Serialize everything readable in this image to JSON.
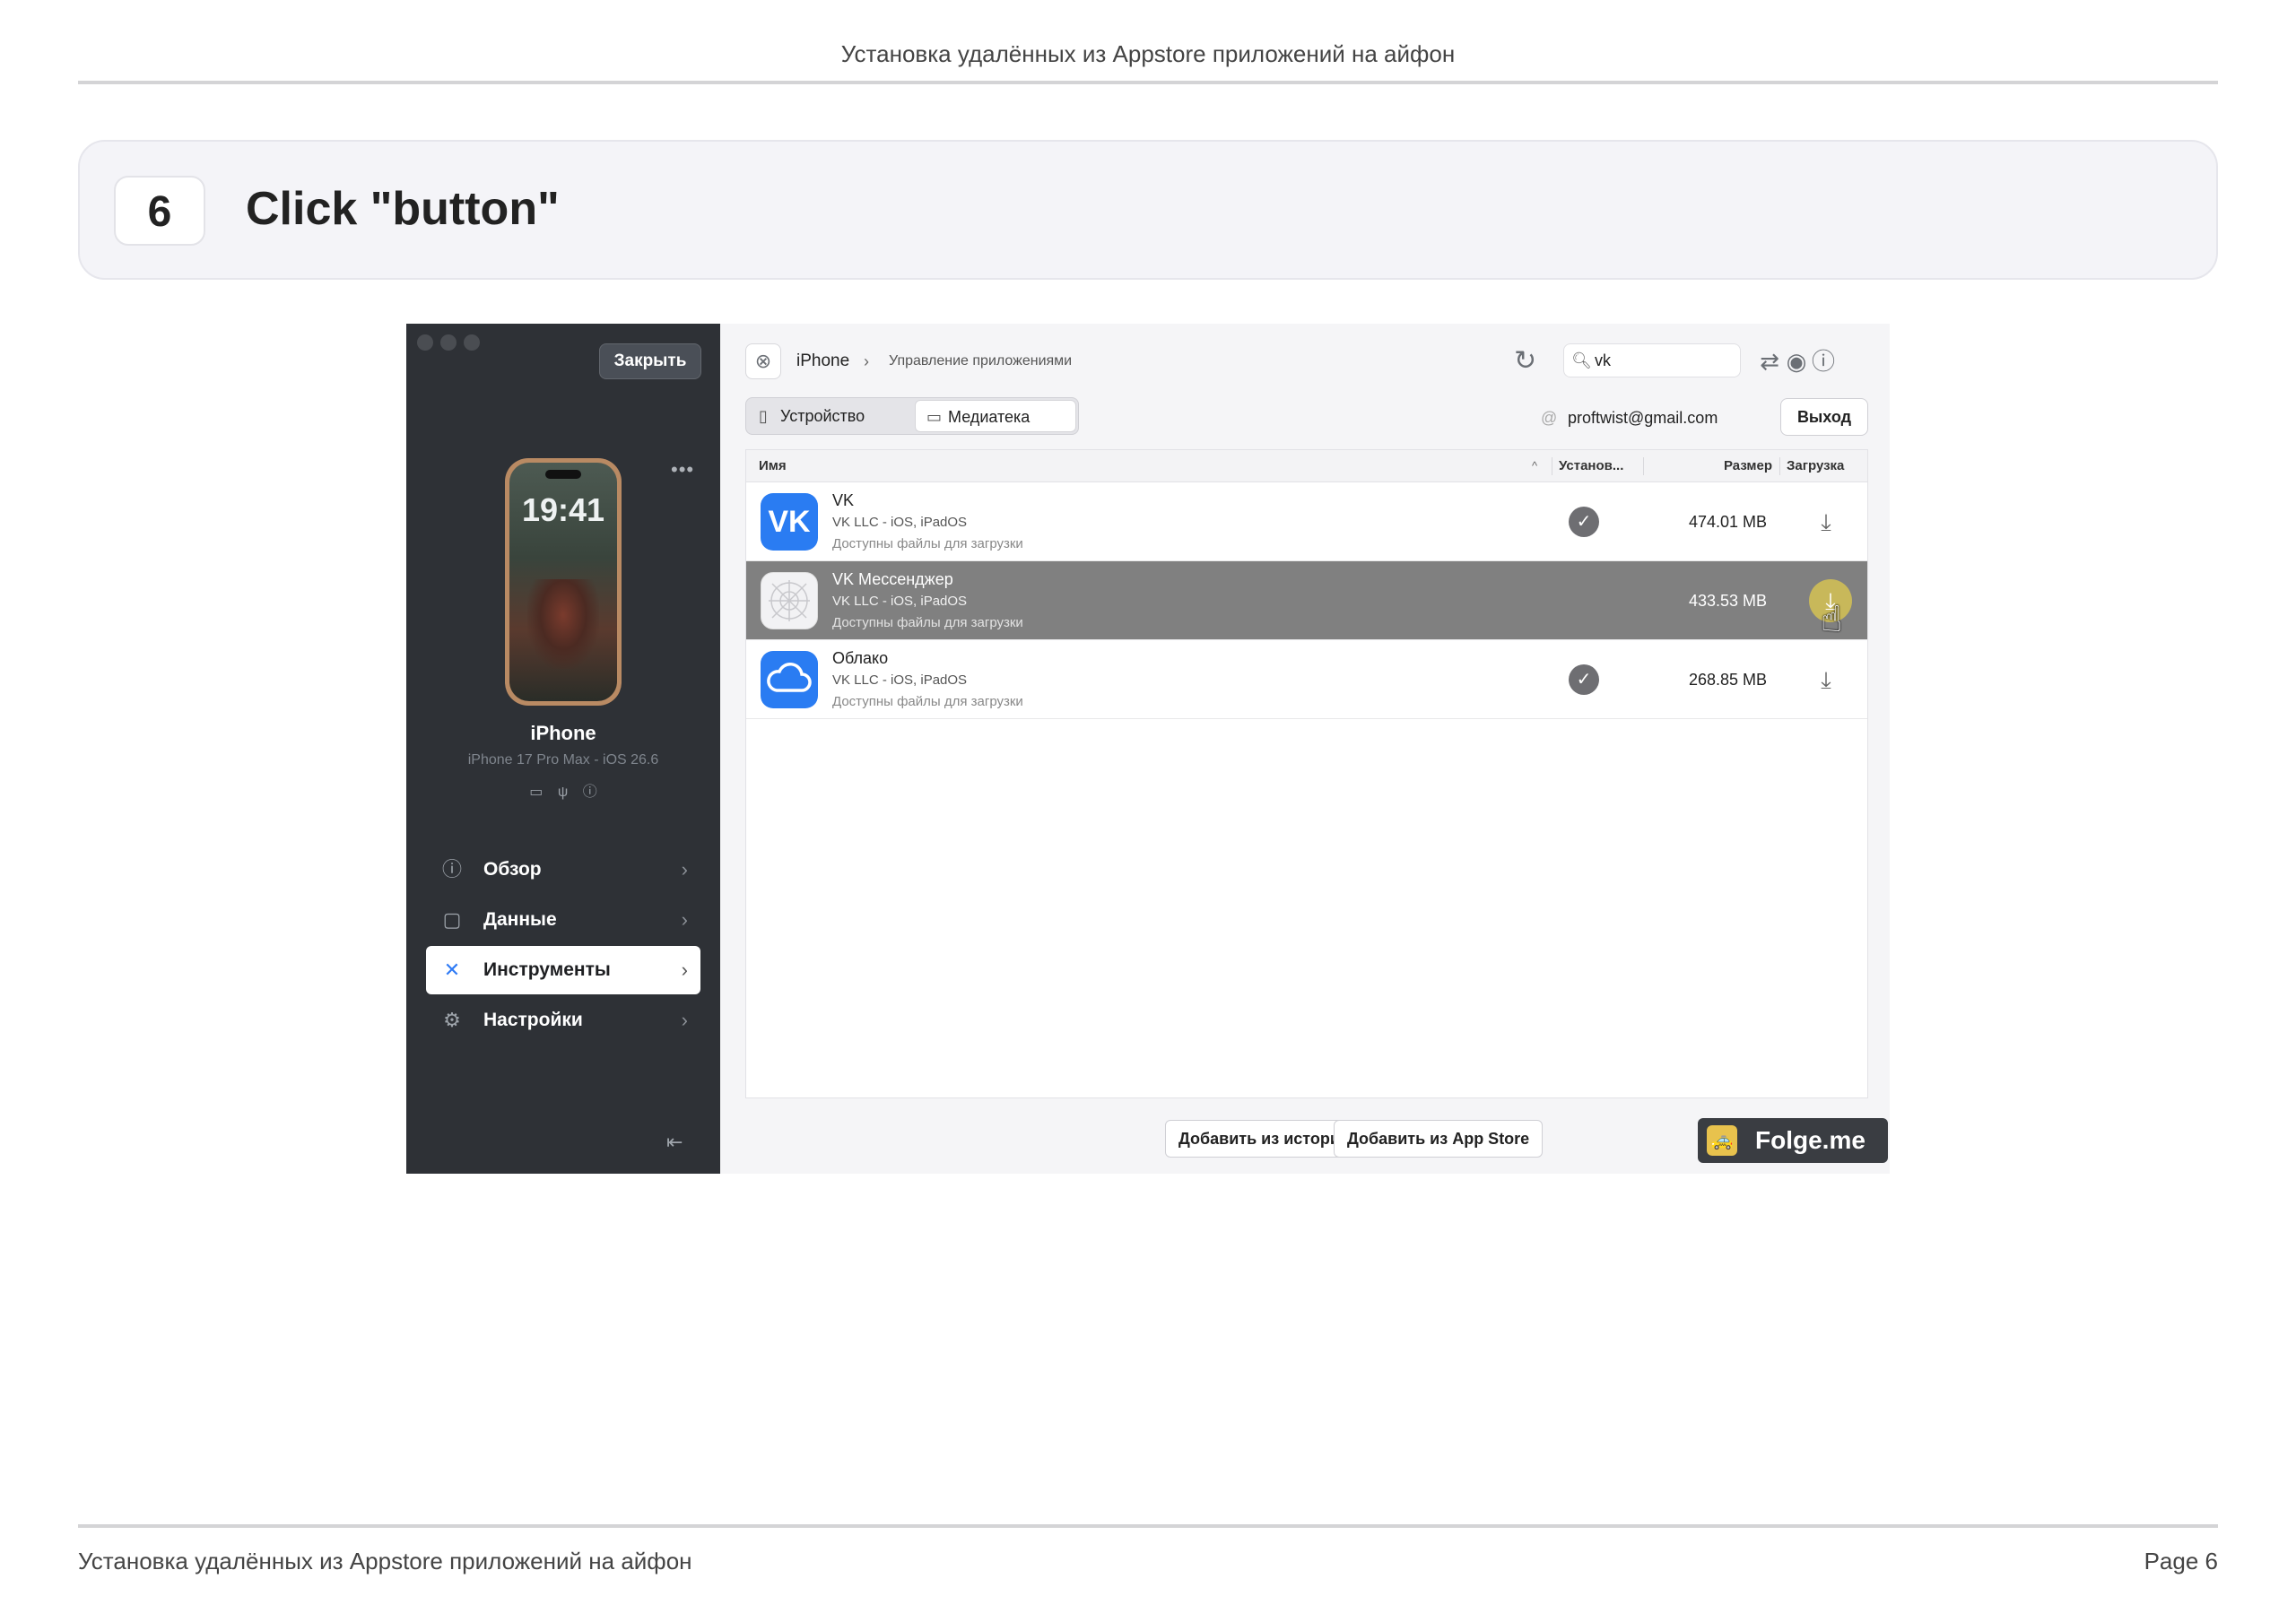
{
  "page": {
    "header_title": "Установка удалённых из Appstore приложений на айфон",
    "footer_title": "Установка удалённых из Appstore приложений на айфон",
    "page_label": "Page 6"
  },
  "step": {
    "number": "6",
    "title": "Click \"button\""
  },
  "app": {
    "sidebar": {
      "close_label": "Закрыть",
      "phone_time": "19:41",
      "device_name": "iPhone",
      "device_model": "iPhone 17 Pro Max - iOS 26.6",
      "nav": [
        {
          "label": "Обзор",
          "icon": "info-icon"
        },
        {
          "label": "Данные",
          "icon": "square-icon"
        },
        {
          "label": "Инструменты",
          "icon": "tools-icon"
        },
        {
          "label": "Настройки",
          "icon": "gear-icon"
        }
      ],
      "active_nav": "Инструменты"
    },
    "toolbar": {
      "breadcrumb_device": "iPhone",
      "breadcrumb_page": "Управление приложениями",
      "search_value": "vk"
    },
    "tabs": [
      {
        "label": "Устройство",
        "icon": "phone-icon"
      },
      {
        "label": "Медиатека",
        "icon": "monitor-icon"
      }
    ],
    "active_tab": "Медиатека",
    "account": "proftwist@gmail.com",
    "logout_label": "Выход",
    "table": {
      "columns": [
        "Имя",
        "Установ...",
        "Размер",
        "Загрузка"
      ],
      "rows": [
        {
          "name": "VK",
          "sub": "VK LLC - iOS, iPadOS",
          "avail": "Доступны файлы для загрузки",
          "installed": true,
          "size": "474.01 MB",
          "icon_color": "#2a7cf2"
        },
        {
          "name": "VK Мессенджер",
          "sub": "VK LLC - iOS, iPadOS",
          "avail": "Доступны файлы для загрузки",
          "installed": false,
          "size": "433.53 MB",
          "icon_color": "#f2f2f4",
          "selected": true
        },
        {
          "name": "Облако",
          "sub": "VK LLC - iOS, iPadOS",
          "avail": "Доступны файлы для загрузки",
          "installed": true,
          "size": "268.85 MB",
          "icon_color": "#2a7cf2"
        }
      ]
    },
    "bottom_buttons": [
      "Добавить из истории покупок",
      "Добавить из App Store"
    ],
    "watermark": "Folge.me"
  }
}
